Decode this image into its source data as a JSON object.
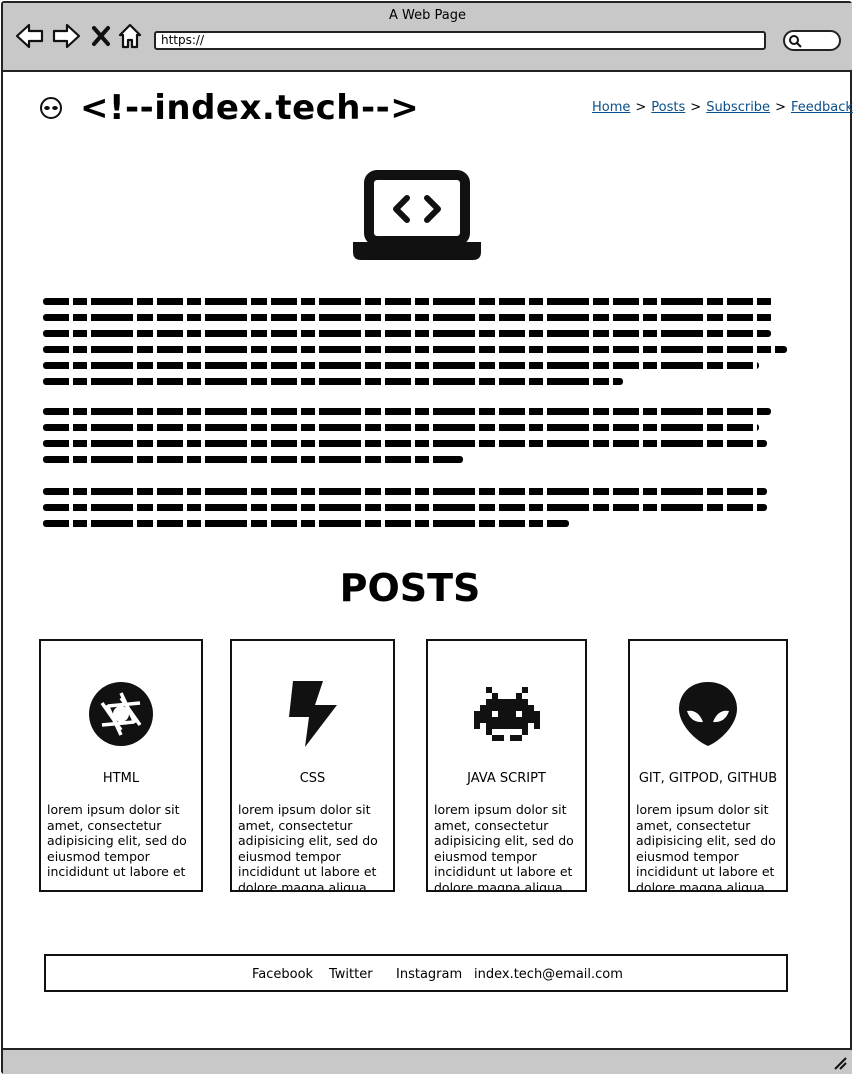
{
  "window": {
    "title": "A Web Page"
  },
  "browser": {
    "url": "https://"
  },
  "header": {
    "brand": "<!--index.tech-->"
  },
  "nav": [
    {
      "label": "Home"
    },
    {
      "label": "Posts"
    },
    {
      "label": "Subscribe"
    },
    {
      "label": "Feedback"
    }
  ],
  "nav_separator": ">",
  "icons": {
    "logo": "alien-icon",
    "hero": "laptop-code-icon",
    "back": "arrow-left-icon",
    "forward": "arrow-right-icon",
    "stop": "close-icon",
    "home": "home-icon",
    "search": "search-icon"
  },
  "posts_heading": "POSTS",
  "posts": [
    {
      "title": "HTML",
      "icon": "aperture-icon",
      "body": "lorem ipsum dolor sit amet, consectetur adipisicing elit, sed do eiusmod tempor incididunt ut labore et"
    },
    {
      "title": "CSS",
      "icon": "lightning-icon",
      "body": "lorem ipsum dolor sit amet, consectetur adipisicing elit, sed do eiusmod tempor incididunt ut labore et dolore magna aliqua. Ut"
    },
    {
      "title": "JAVA SCRIPT",
      "icon": "space-invader-icon",
      "body": "lorem ipsum dolor sit amet, consectetur adipisicing elit, sed do eiusmod tempor incididunt ut labore et dolore magna aliqua. Ut"
    },
    {
      "title": "GIT, GITPOD, GITHUB",
      "icon": "alien-head-icon",
      "body": "lorem ipsum dolor sit amet, consectetur adipisicing elit, sed do eiusmod tempor incididunt ut labore et dolore magna aliqua. Ut"
    }
  ],
  "footer": {
    "facebook": "Facebook",
    "twitter": "Twitter",
    "instagram": "Instagram",
    "email": "index.tech@email.com"
  },
  "colors": {
    "link": "#0b4f8a",
    "chrome": "#c8c8c8"
  }
}
